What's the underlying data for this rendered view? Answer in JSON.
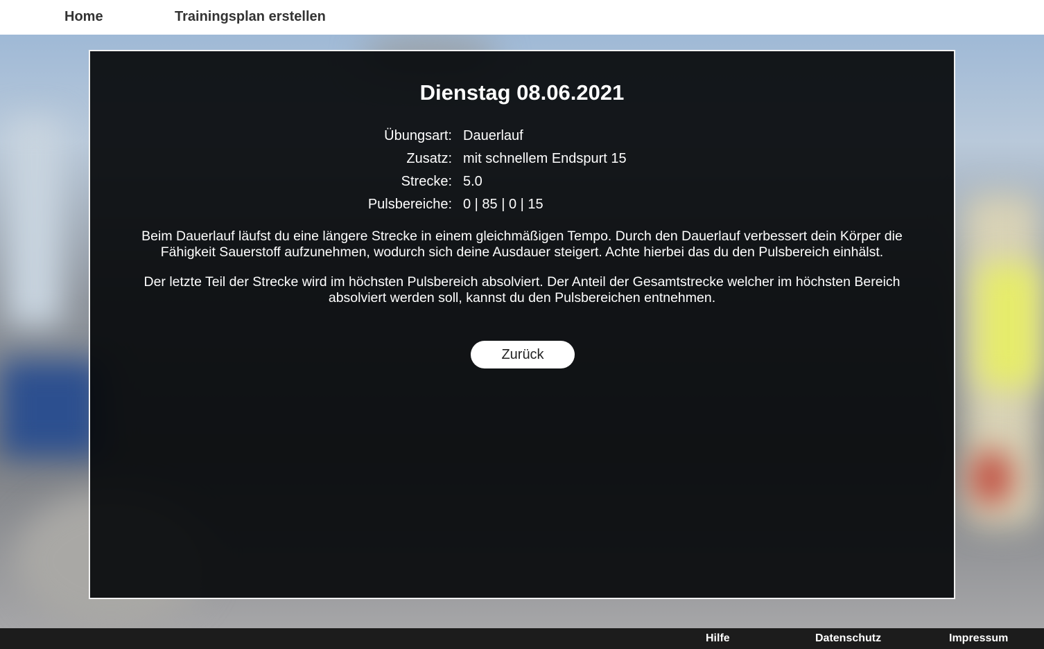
{
  "nav": {
    "home_label": "Home",
    "plan_label": "Trainingsplan erstellen"
  },
  "panel": {
    "title": "Dienstag 08.06.2021",
    "details": [
      {
        "label": "Übungsart:",
        "value": "Dauerlauf"
      },
      {
        "label": "Zusatz:",
        "value": "mit schnellem Endspurt 15"
      },
      {
        "label": "Strecke:",
        "value": "5.0"
      },
      {
        "label": "Pulsbereiche:",
        "value": "0 | 85 | 0 | 15"
      }
    ],
    "description_1": "Beim Dauerlauf läufst du eine längere Strecke in einem gleichmäßigen Tempo. Durch den Dauerlauf verbessert dein Körper die Fähigkeit Sauerstoff aufzunehmen, wodurch sich deine Ausdauer steigert. Achte hierbei das du den Pulsbereich einhälst.",
    "description_2": "Der letzte Teil der Strecke wird im höchsten Pulsbereich absolviert. Der Anteil der Gesamtstrecke welcher im höchsten Bereich absolviert werden soll, kannst du den Pulsbereichen entnehmen.",
    "back_label": "Zurück"
  },
  "footer": {
    "hilfe_label": "Hilfe",
    "datenschutz_label": "Datenschutz",
    "impressum_label": "Impressum"
  },
  "colors": {
    "panel_background": "#0a0c0e",
    "panel_border": "#f2f2f2",
    "footer_background": "#1c1c1c",
    "nav_text": "#333333"
  }
}
